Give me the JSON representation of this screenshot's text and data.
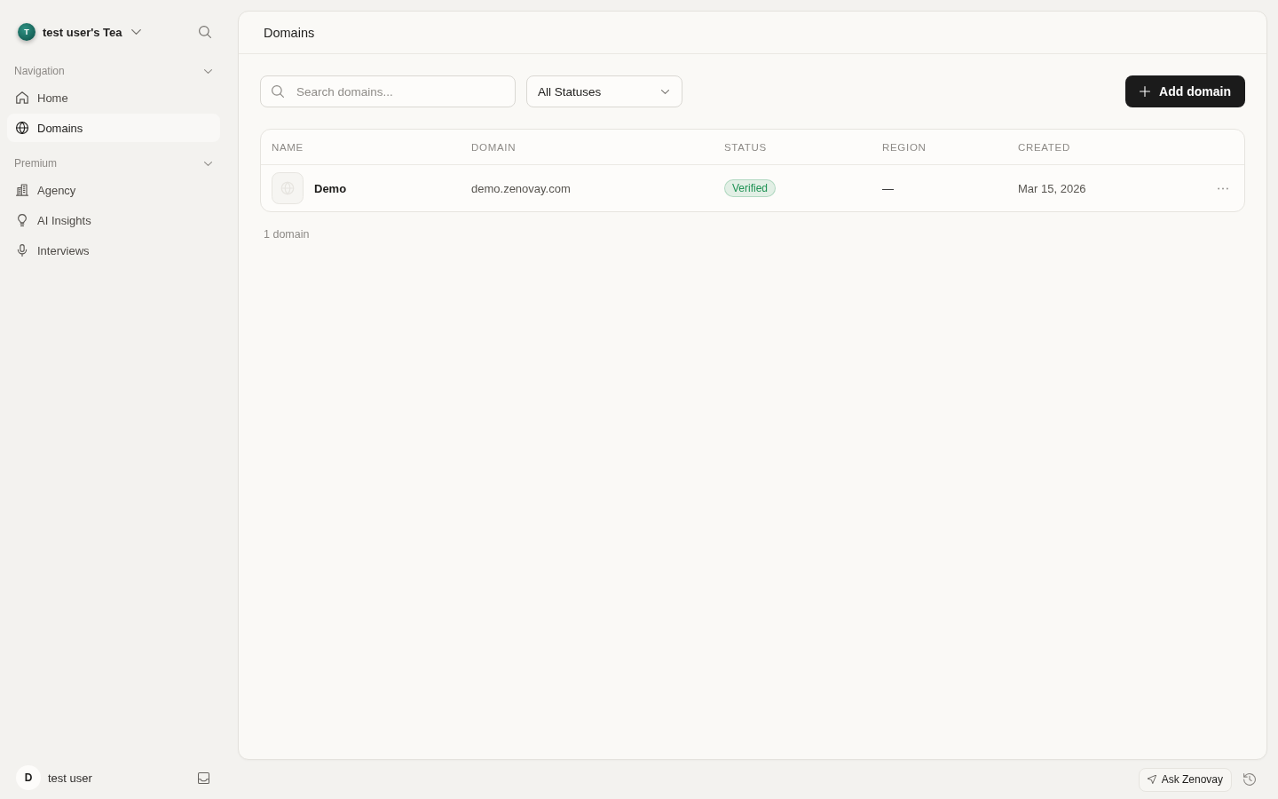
{
  "sidebar": {
    "team": {
      "initial": "T",
      "name": "test user's Tea"
    },
    "sections": [
      {
        "title": "Navigation",
        "expanded": true,
        "items": [
          {
            "label": "Home",
            "selected": false
          },
          {
            "label": "Domains",
            "selected": true
          }
        ]
      },
      {
        "title": "Premium",
        "expanded": true,
        "items": [
          {
            "label": "Agency",
            "selected": false
          },
          {
            "label": "AI Insights",
            "selected": false
          },
          {
            "label": "Interviews",
            "selected": false
          }
        ]
      }
    ],
    "user": {
      "initial": "D",
      "name": "test user"
    }
  },
  "page": {
    "title": "Domains"
  },
  "toolbar": {
    "search": {
      "placeholder": "Search domains..."
    },
    "status_filter": {
      "value": "All Statuses"
    },
    "add_button": {
      "label": "Add domain"
    }
  },
  "table": {
    "columns": [
      "NAME",
      "DOMAIN",
      "STATUS",
      "REGION",
      "CREATED"
    ],
    "rows": [
      {
        "name": "Demo",
        "domain": "demo.zenovay.com",
        "status": {
          "label": "Verified",
          "color": "#1f9254"
        },
        "region": "—",
        "created": "Mar 15, 2026"
      }
    ]
  },
  "footer": {
    "count": "1 domain"
  },
  "assistant_bar": {
    "ask_button": "Ask Zenovay"
  }
}
